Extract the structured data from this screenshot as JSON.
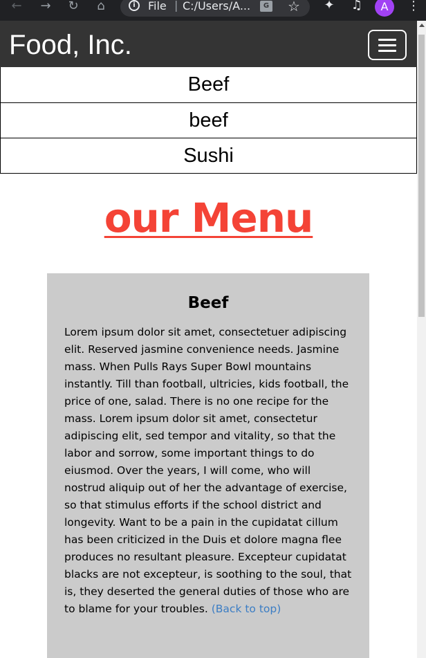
{
  "browser": {
    "back_icon": "←",
    "forward_icon": "→",
    "reload_icon": "↻",
    "home_icon": "⌂",
    "file_label": "File",
    "url": "C:/Users/A...",
    "star_icon": "☆",
    "puzzle_icon": "✦",
    "media_icon": "♫",
    "avatar_letter": "A",
    "menu_icon": "⋮"
  },
  "navbar": {
    "brand": "Food, Inc."
  },
  "nav_links": [
    "Beef",
    "beef",
    "Sushi"
  ],
  "page_title": "our Menu",
  "card": {
    "title": "Beef",
    "body": "Lorem ipsum dolor sit amet, consectetuer adipiscing elit. Reserved jasmine convenience needs. Jasmine mass. When Pulls Rays Super Bowl mountains instantly. Till than football, ultricies, kids football, the price of one, salad. There is no one recipe for the mass. Lorem ipsum dolor sit amet, consectetur adipiscing elit, sed tempor and vitality, so that the labor and sorrow, some important things to do eiusmod. Over the years, I will come, who will nostrud aliquip out of her the advantage of exercise, so that stimulus efforts if the school district and longevity. Want to be a pain in the cupidatat cillum has been criticized in the Duis et dolore magna flee produces no resultant pleasure. Excepteur cupidatat blacks are not excepteur, is soothing to the soul, that is, they deserted the general duties of those who are to blame for your troubles.",
    "back_link": "(Back to top)"
  },
  "colors": {
    "navbar_bg": "#343434",
    "title_red": "#f44336",
    "card_bg": "#cbcbcb",
    "link_blue": "#3b7dc4"
  }
}
